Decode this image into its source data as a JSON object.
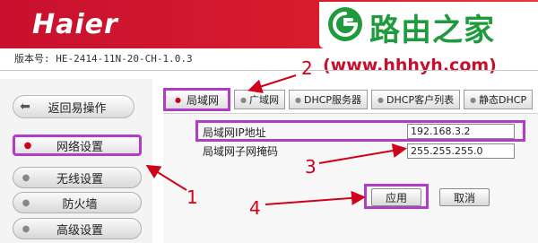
{
  "header": {
    "logo": "Haier",
    "brand": "路由之家",
    "site_url": "(www.hhhyh.com)"
  },
  "version": "版本号: HE-2414-11N-20-CH-1.0.3",
  "sidebar": {
    "back_label": "返回易操作",
    "items": [
      {
        "label": "网络设置",
        "active": true
      },
      {
        "label": "无线设置",
        "active": false
      },
      {
        "label": "防火墙",
        "active": false
      },
      {
        "label": "高级设置",
        "active": false
      }
    ]
  },
  "tabs": [
    {
      "label": "局域网",
      "active": true
    },
    {
      "label": "广域网",
      "active": false
    },
    {
      "label": "DHCP服务器",
      "active": false
    },
    {
      "label": "DHCP客户列表",
      "active": false
    },
    {
      "label": "静态DHCP",
      "active": false
    }
  ],
  "form": {
    "ip_label": "局域网IP地址",
    "ip_value": "192.168.3.2",
    "mask_label": "局域网子网掩码",
    "mask_value": "255.255.255.0"
  },
  "buttons": {
    "apply": "应用",
    "cancel": "取消"
  },
  "annotations": {
    "n1": "1",
    "n2": "2",
    "n3": "3",
    "n4": "4"
  },
  "colors": {
    "header_red": "#c8102e",
    "highlight_purple": "#b23cc6",
    "annotation_red": "#d0021b",
    "brand_green": "#1f9b3d"
  }
}
